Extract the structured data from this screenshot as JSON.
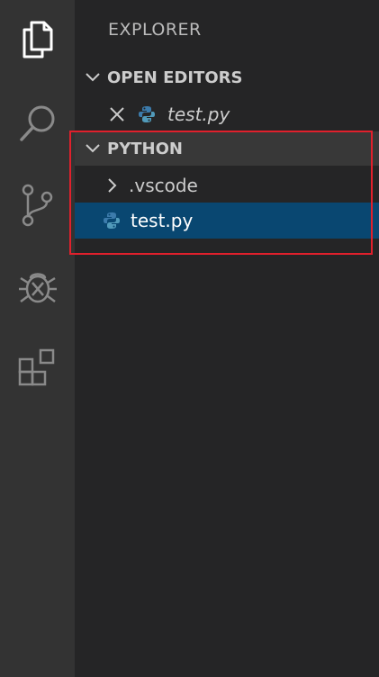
{
  "activity_bar": {
    "items": [
      {
        "icon": "files-icon"
      },
      {
        "icon": "search-icon"
      },
      {
        "icon": "source-control-icon"
      },
      {
        "icon": "debug-icon"
      },
      {
        "icon": "extensions-icon"
      }
    ]
  },
  "sidebar": {
    "title": "EXPLORER",
    "open_editors": {
      "label": "OPEN EDITORS",
      "items": [
        {
          "name": "test.py",
          "icon": "python-file-icon",
          "close_icon": "close-icon"
        }
      ]
    },
    "workspace": {
      "label": "PYTHON",
      "items": [
        {
          "name": ".vscode",
          "type": "folder",
          "icon": "chevron-right-icon"
        },
        {
          "name": "test.py",
          "type": "file",
          "icon": "python-file-icon",
          "selected": true
        }
      ]
    }
  },
  "colors": {
    "activity_bar": "#333333",
    "sidebar": "#252526",
    "section_header": "#383838",
    "selection": "#094771",
    "highlight_border": "#e0202c",
    "python_blue": "#3c7bab",
    "python_yellow": "#519aba"
  }
}
